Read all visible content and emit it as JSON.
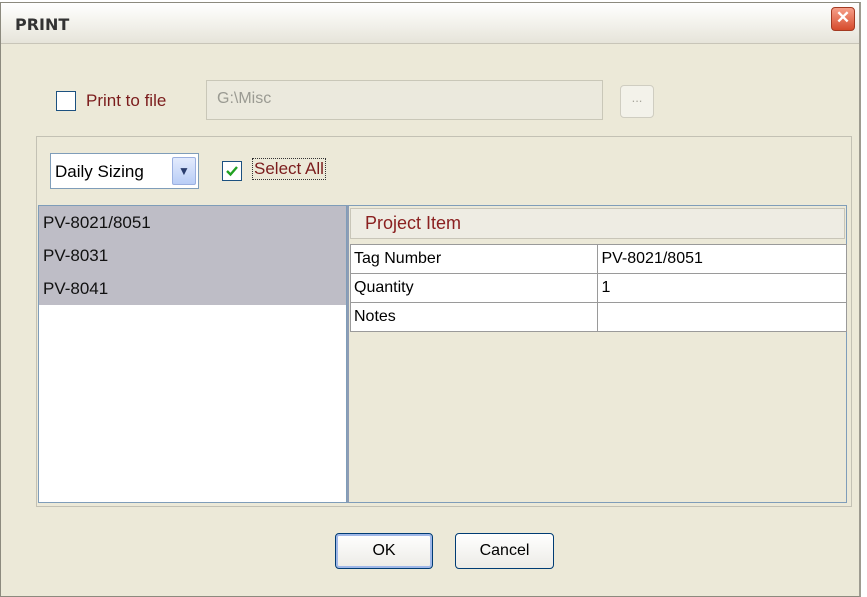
{
  "dialog": {
    "title": "PRINT",
    "close_icon": "close-icon"
  },
  "print_to_file": {
    "label": "Print to file",
    "checked": false,
    "path_value": "G:\\Misc",
    "browse_label": "..."
  },
  "filter": {
    "selected": "Daily Sizing",
    "select_all_label": "Select All",
    "select_all_checked": true
  },
  "items": [
    "PV-8021/8051",
    "PV-8031",
    "PV-8041"
  ],
  "properties": {
    "title": "Project Item",
    "rows": [
      {
        "name": "Tag Number",
        "value": "PV-8021/8051"
      },
      {
        "name": "Quantity",
        "value": "1"
      },
      {
        "name": "Notes",
        "value": ""
      }
    ]
  },
  "buttons": {
    "ok": "OK",
    "cancel": "Cancel"
  },
  "colors": {
    "accent_label": "#7b1c1c",
    "check_green": "#21a121",
    "list_selected": "#bebdc6"
  }
}
